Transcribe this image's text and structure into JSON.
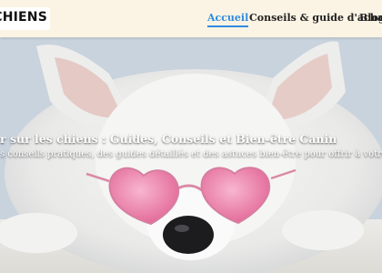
{
  "header": {
    "logo_text": "E-CHIENS",
    "nav": [
      {
        "label": "Accueil",
        "active": true
      },
      {
        "label": "Conseils & guide d'achat",
        "active": false
      },
      {
        "label": "Blog",
        "active": false
      }
    ]
  },
  "hero": {
    "title": "r sur les chiens : Guides, Conseils et Bien-être Canin",
    "subtitle": "s conseils pratiques, des guides détaillés et des astuces bien-être pour offrir à votre chien une vi"
  },
  "colors": {
    "header_bg": "#fbf4e4",
    "active_nav": "#2f8be0",
    "glasses": "#f08fb4"
  }
}
